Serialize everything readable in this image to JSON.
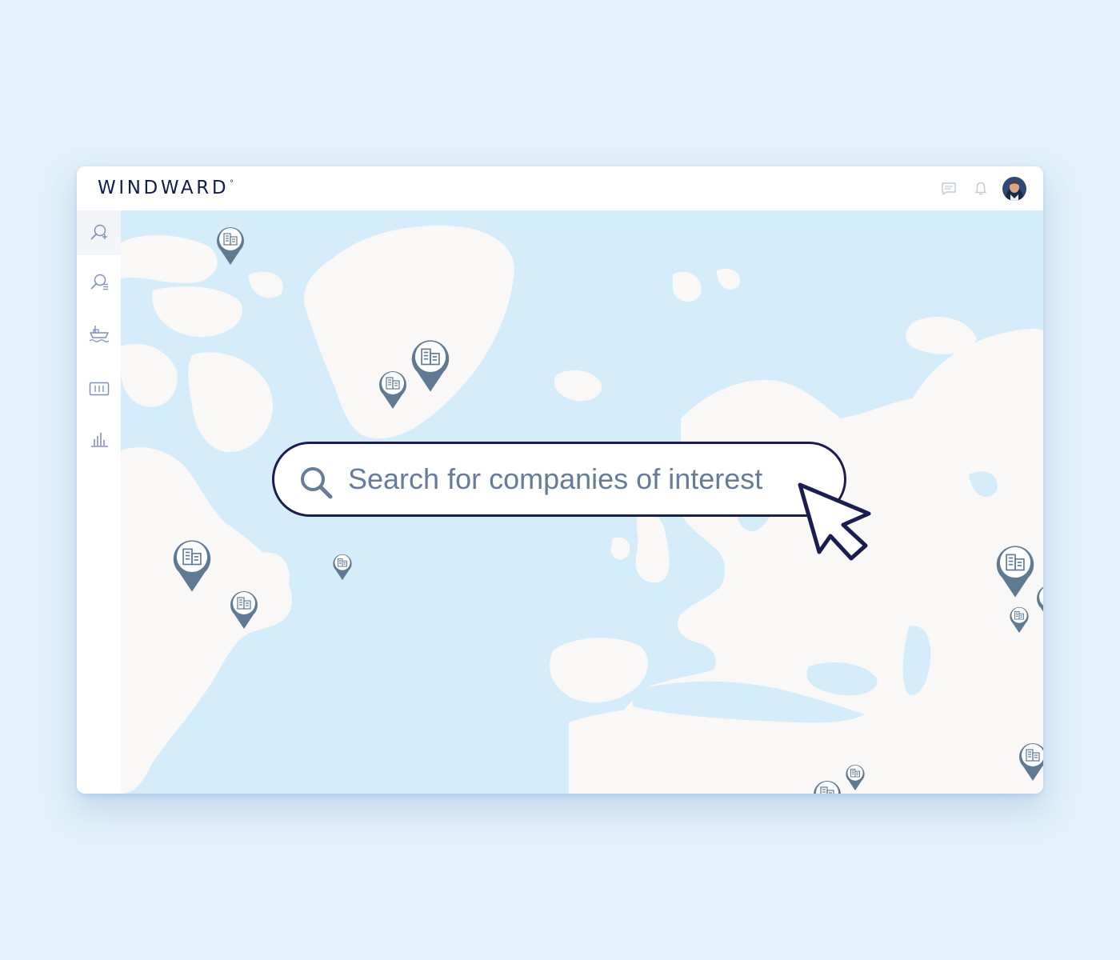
{
  "app": {
    "brand": "WINDWARD",
    "brand_mark": "°"
  },
  "topbar": {
    "icons": [
      "chat-icon",
      "bell-icon",
      "user-avatar"
    ]
  },
  "sidebar": {
    "items": [
      {
        "icon": "search-plus-icon",
        "active": true
      },
      {
        "icon": "search-list-icon",
        "active": false
      },
      {
        "icon": "ship-icon",
        "active": false
      },
      {
        "icon": "container-icon",
        "active": false
      },
      {
        "icon": "bar-chart-icon",
        "active": false
      }
    ]
  },
  "search": {
    "placeholder": "Search for companies of interest"
  },
  "map": {
    "marker_icon": "company-building-icon",
    "colors": {
      "water": "#d5ecfb",
      "land": "#faf8f7",
      "pin": "#5f7a92",
      "outline": "#1a1d4e"
    }
  }
}
